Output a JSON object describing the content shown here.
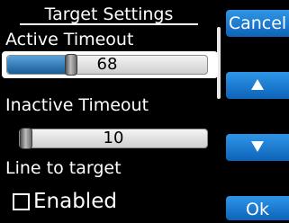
{
  "title": "Target Settings",
  "cancel_label": "Cancel",
  "ok_label": "Ok",
  "up_icon": "arrow-up-icon",
  "down_icon": "arrow-down-icon",
  "active_timeout": {
    "label": "Active Timeout",
    "value": "68",
    "fraction": 0.31
  },
  "inactive_timeout": {
    "label": "Inactive Timeout",
    "value": "10",
    "fraction": 0.0
  },
  "line_to_target": {
    "label": "Line to target",
    "checkbox_label": "Enabled",
    "checked": false
  },
  "colors": {
    "button": "#1a7bd4",
    "slider_fill": "#2a78b8",
    "background": "#000000"
  }
}
